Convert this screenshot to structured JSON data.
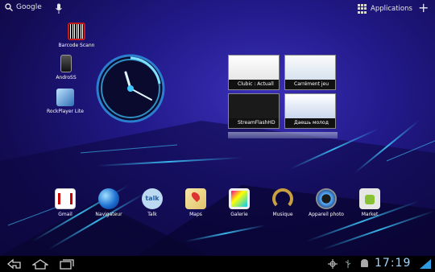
{
  "topbar": {
    "search_label": "Google",
    "apps_label": "Applications",
    "add_label": "+"
  },
  "shortcuts": [
    {
      "label": "Barcode Scann"
    },
    {
      "label": "AndroSS"
    },
    {
      "label": "RockPlayer Lite"
    }
  ],
  "browser_widget": {
    "tabs": [
      {
        "title": "Clubic : Actuall"
      },
      {
        "title": "Carrément jeu"
      },
      {
        "title": "StreamFlashHD"
      },
      {
        "title": "Даешь молод"
      }
    ]
  },
  "dock": [
    {
      "label": "Gmail"
    },
    {
      "label": "Navigateur"
    },
    {
      "label": "Talk",
      "icon_text": "talk"
    },
    {
      "label": "Maps"
    },
    {
      "label": "Galerie"
    },
    {
      "label": "Musique"
    },
    {
      "label": "Appareil photo"
    },
    {
      "label": "Market"
    }
  ],
  "systembar": {
    "time": "17:19"
  },
  "colors": {
    "wallpaper": "#221a8a",
    "accent_lines": "#3fc8ff",
    "clock_text": "#9fd4ff"
  },
  "icons": [
    "search-icon",
    "mic-icon",
    "apps-grid-icon",
    "add-icon",
    "back-icon",
    "home-icon",
    "recent-apps-icon",
    "location-icon",
    "usb-icon",
    "android-icon",
    "signal-icon"
  ]
}
